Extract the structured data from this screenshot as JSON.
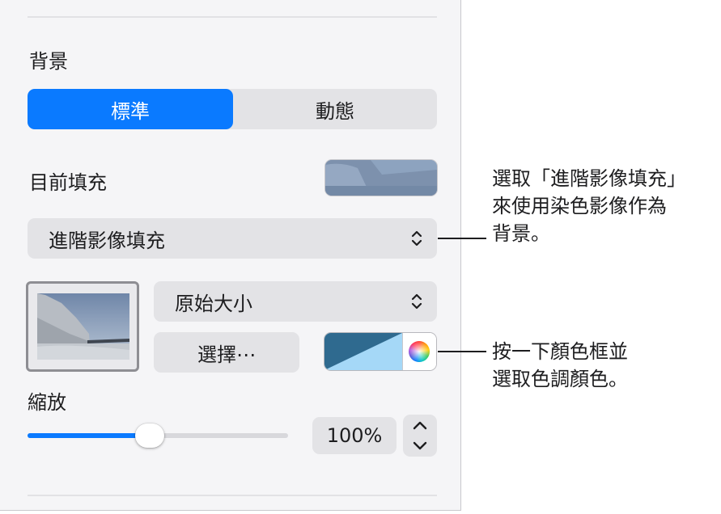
{
  "panel": {
    "background_label": "背景",
    "segments": [
      {
        "label": "標準",
        "selected": true
      },
      {
        "label": "動態",
        "selected": false
      }
    ],
    "current_fill_label": "目前填充",
    "fill_type_value": "進階影像填充",
    "image_scale_value": "原始大小",
    "choose_button_label": "選擇⋯",
    "scale_label": "縮放",
    "scale_value": "100%",
    "scale_slider_fraction": 0.47
  },
  "callouts": {
    "fill_type_note": [
      "選取「進階影像填充」",
      "來使用染色影像作為",
      "背景。"
    ],
    "color_note": [
      "按一下顏色框並",
      "選取色調顏色。"
    ]
  },
  "colors": {
    "accent": "#0a7aff",
    "tint_dark": "#2f6a8f",
    "tint_light": "#a5d8f7"
  },
  "icons": {
    "popup_stepper": "chevron-up-down-icon",
    "color_picker": "color-wheel-icon",
    "stepper_up": "chevron-up-icon",
    "stepper_down": "chevron-down-icon"
  }
}
